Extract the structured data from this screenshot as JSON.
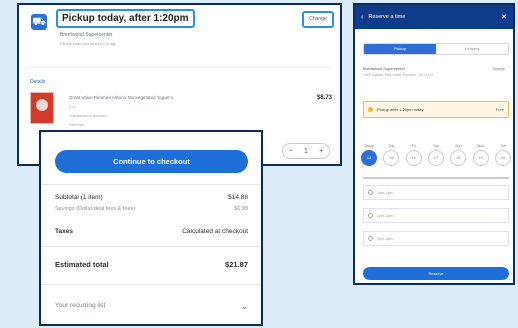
{
  "cart": {
    "pickup_title": "Pickup today, after 1:20pm",
    "store_line": "Brentwood Supercenter",
    "avail_line": "Fill the slots you order for today",
    "change_label": "Change",
    "details_link": "Details",
    "product_name": "Great Value Rimmed Arborio Nonvegetated Yogurt 1",
    "product_sub1": "1 ct",
    "product_sub2": "Substitutions allowed",
    "product_sub3": "Remove",
    "product_price": "$8.73",
    "qty_minus": "−",
    "qty_value": "1",
    "qty_plus": "+"
  },
  "checkout": {
    "cta_label": "Continue to checkout",
    "subtotal_label": "Subtotal (1 item)",
    "subtotal_value": "$14.88",
    "savings_label": "Savings (Dollar deal fees & fees)",
    "savings_value": "$6.99",
    "taxes_label": "Taxes",
    "taxes_value": "Calculated at checkout",
    "est_label": "Estimated total",
    "est_value": "$21.87",
    "promo_label": "Your recurring list"
  },
  "modal": {
    "title": "Reserve a time",
    "tab_pickup": "Pickup",
    "tab_delivery": "Delivery",
    "store": "Brentwood Supercenter",
    "store_addr": "1500 Gallatin Pike North, Madison, TN 37115",
    "change": "Change",
    "pickup_box": "Pickup after 1:20pm today",
    "pickup_fee": "Free",
    "days": [
      {
        "name": "Today",
        "num": "14"
      },
      {
        "name": "Thu",
        "num": "15"
      },
      {
        "name": "Fri",
        "num": "16"
      },
      {
        "name": "Sat",
        "num": "17"
      },
      {
        "name": "Sun",
        "num": "18"
      },
      {
        "name": "Mon",
        "num": "19"
      },
      {
        "name": "Tue",
        "num": "20"
      }
    ],
    "slots": [
      "1pm–2pm",
      "2pm–3pm",
      "3pm–4pm"
    ],
    "reserve_label": "Reserve"
  }
}
